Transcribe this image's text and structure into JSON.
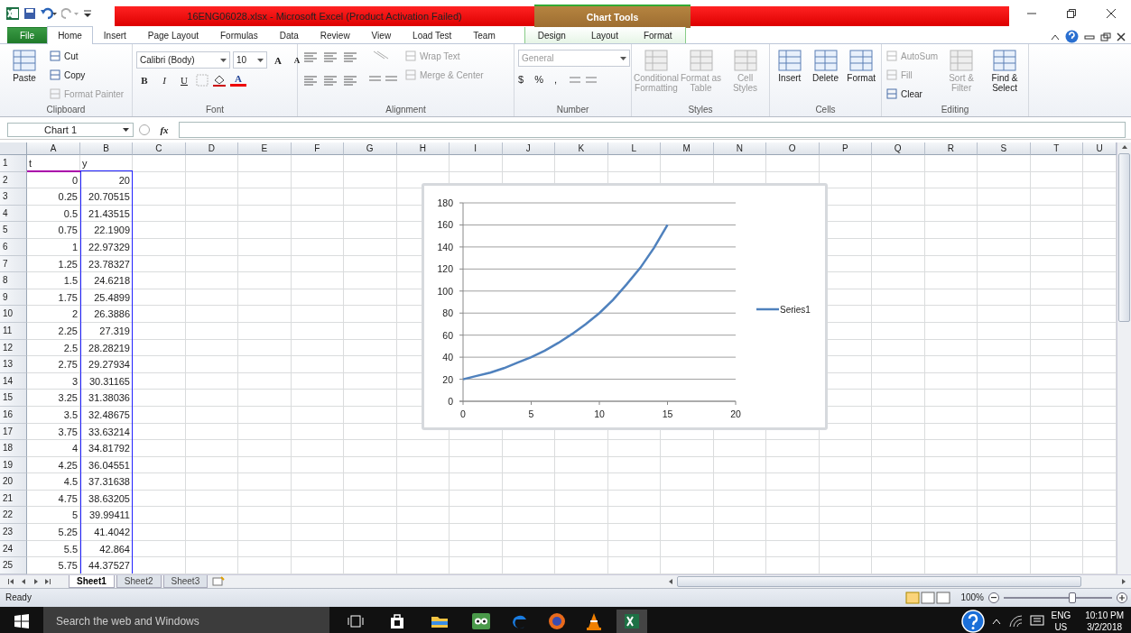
{
  "title_bar": {
    "title": "16ENG06028.xlsx  -  Microsoft Excel (Product Activation Failed)",
    "contextual_group": "Chart Tools"
  },
  "tabs": [
    {
      "label": "File",
      "kind": "file",
      "selected": false
    },
    {
      "label": "Home",
      "kind": "normal",
      "selected": true
    },
    {
      "label": "Insert",
      "kind": "normal",
      "selected": false
    },
    {
      "label": "Page Layout",
      "kind": "normal",
      "selected": false
    },
    {
      "label": "Formulas",
      "kind": "normal",
      "selected": false
    },
    {
      "label": "Data",
      "kind": "normal",
      "selected": false
    },
    {
      "label": "Review",
      "kind": "normal",
      "selected": false
    },
    {
      "label": "View",
      "kind": "normal",
      "selected": false
    },
    {
      "label": "Load Test",
      "kind": "normal",
      "selected": false
    },
    {
      "label": "Team",
      "kind": "normal",
      "selected": false
    }
  ],
  "chart_tabs": [
    {
      "label": "Design",
      "selected": false
    },
    {
      "label": "Layout",
      "selected": false
    },
    {
      "label": "Format",
      "selected": false
    }
  ],
  "ribbon": {
    "groups": [
      {
        "kind": "clipboard",
        "label": "Clipboard",
        "large": [
          {
            "label": "Paste",
            "disabled": false
          }
        ],
        "small": [
          {
            "label": "Cut",
            "disabled": false
          },
          {
            "label": "Copy",
            "disabled": false
          },
          {
            "label": "Format Painter",
            "disabled": true
          }
        ]
      },
      {
        "kind": "font",
        "label": "Font",
        "font_name": "Calibri (Body)",
        "font_size": "10",
        "grow": "A",
        "shrink": "A",
        "styles": [
          "B",
          "I",
          "U"
        ],
        "font_color": "A"
      },
      {
        "kind": "alignment",
        "label": "Alignment",
        "small": [
          {
            "label": "Wrap Text",
            "disabled": true
          },
          {
            "label": "Merge & Center",
            "disabled": true
          }
        ]
      },
      {
        "kind": "number",
        "label": "Number",
        "format": "General",
        "disabled": true,
        "symbols": [
          "$",
          "%",
          ","
        ]
      },
      {
        "kind": "large",
        "label": "Styles",
        "large": [
          {
            "label": "Conditional Formatting",
            "disabled": true
          },
          {
            "label": "Format as Table",
            "disabled": true
          },
          {
            "label": "Cell Styles",
            "disabled": true
          }
        ]
      },
      {
        "kind": "large",
        "label": "Cells",
        "large": [
          {
            "label": "Insert",
            "disabled": false
          },
          {
            "label": "Delete",
            "disabled": false
          },
          {
            "label": "Format",
            "disabled": false
          }
        ]
      },
      {
        "kind": "editing",
        "label": "Editing",
        "small": [
          {
            "label": "AutoSum",
            "disabled": true
          },
          {
            "label": "Fill",
            "disabled": true
          },
          {
            "label": "Clear",
            "disabled": false
          }
        ],
        "large": [
          {
            "label": "Sort & Filter",
            "disabled": true
          },
          {
            "label": "Find & Select",
            "disabled": false
          }
        ]
      }
    ]
  },
  "formula_bar": {
    "name_box": "Chart 1",
    "function_label": "fx"
  },
  "sheet": {
    "range_highlighted": true,
    "columns": [
      "A",
      "B",
      "C",
      "D",
      "E",
      "F",
      "G",
      "H",
      "I",
      "J",
      "K",
      "L",
      "M",
      "N",
      "O",
      "P",
      "Q",
      "R",
      "S",
      "T",
      "U"
    ],
    "rows": [
      {
        "number": "1",
        "kind": "text",
        "cells": [
          "t",
          "y"
        ]
      },
      {
        "number": "2",
        "kind": "number",
        "cells": [
          "0",
          "20"
        ]
      },
      {
        "number": "3",
        "kind": "number",
        "cells": [
          "0.25",
          "20.70515"
        ]
      },
      {
        "number": "4",
        "kind": "number",
        "cells": [
          "0.5",
          "21.43515"
        ]
      },
      {
        "number": "5",
        "kind": "number",
        "cells": [
          "0.75",
          "22.1909"
        ]
      },
      {
        "number": "6",
        "kind": "number",
        "cells": [
          "1",
          "22.97329"
        ]
      },
      {
        "number": "7",
        "kind": "number",
        "cells": [
          "1.25",
          "23.78327"
        ]
      },
      {
        "number": "8",
        "kind": "number",
        "cells": [
          "1.5",
          "24.6218"
        ]
      },
      {
        "number": "9",
        "kind": "number",
        "cells": [
          "1.75",
          "25.4899"
        ]
      },
      {
        "number": "10",
        "kind": "number",
        "cells": [
          "2",
          "26.3886"
        ]
      },
      {
        "number": "11",
        "kind": "number",
        "cells": [
          "2.25",
          "27.319"
        ]
      },
      {
        "number": "12",
        "kind": "number",
        "cells": [
          "2.5",
          "28.28219"
        ]
      },
      {
        "number": "13",
        "kind": "number",
        "cells": [
          "2.75",
          "29.27934"
        ]
      },
      {
        "number": "14",
        "kind": "number",
        "cells": [
          "3",
          "30.31165"
        ]
      },
      {
        "number": "15",
        "kind": "number",
        "cells": [
          "3.25",
          "31.38036"
        ]
      },
      {
        "number": "16",
        "kind": "number",
        "cells": [
          "3.5",
          "32.48675"
        ]
      },
      {
        "number": "17",
        "kind": "number",
        "cells": [
          "3.75",
          "33.63214"
        ]
      },
      {
        "number": "18",
        "kind": "number",
        "cells": [
          "4",
          "34.81792"
        ]
      },
      {
        "number": "19",
        "kind": "number",
        "cells": [
          "4.25",
          "36.04551"
        ]
      },
      {
        "number": "20",
        "kind": "number",
        "cells": [
          "4.5",
          "37.31638"
        ]
      },
      {
        "number": "21",
        "kind": "number",
        "cells": [
          "4.75",
          "38.63205"
        ]
      },
      {
        "number": "22",
        "kind": "number",
        "cells": [
          "5",
          "39.99411"
        ]
      },
      {
        "number": "23",
        "kind": "number",
        "cells": [
          "5.25",
          "41.4042"
        ]
      },
      {
        "number": "24",
        "kind": "number",
        "cells": [
          "5.5",
          "42.864"
        ]
      },
      {
        "number": "25",
        "kind": "number",
        "cells": [
          "5.75",
          "44.37527"
        ]
      }
    ],
    "chart": {
      "chart_data": {
        "type": "line",
        "x": [
          0,
          1,
          2,
          3,
          4,
          5,
          6,
          7,
          8,
          9,
          10,
          11,
          12,
          13,
          14,
          15
        ],
        "series": [
          {
            "name": "Series1",
            "color": "#4f81bd",
            "values": [
              20,
              23,
              26,
              30,
              35,
              40,
              46,
              53,
              61,
              70,
              80,
              92,
              106,
              121,
              139,
              160
            ]
          }
        ],
        "grid": true,
        "xlim": [
          0,
          20
        ],
        "ylim": [
          0,
          180
        ],
        "xticks": [
          0,
          5,
          10,
          15,
          20
        ],
        "yticks": [
          0,
          20,
          40,
          60,
          80,
          100,
          120,
          140,
          160,
          180
        ]
      }
    }
  },
  "sheet_tabs": [
    {
      "label": "Sheet1",
      "selected": true
    },
    {
      "label": "Sheet2",
      "selected": false
    },
    {
      "label": "Sheet3",
      "selected": false
    }
  ],
  "status_bar": {
    "status": "Ready",
    "zoom": "100%",
    "zoom_slider": {
      "level": 0.63
    }
  },
  "taskbar": {
    "search_placeholder": "Search the web and Windows",
    "language": "ENG",
    "region": "US",
    "time": "10:10 PM",
    "date": "3/2/2018"
  }
}
